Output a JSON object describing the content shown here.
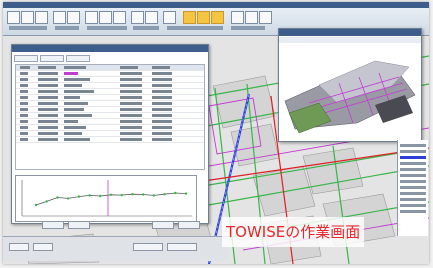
{
  "caption": {
    "text": "TOWISEの作業画面",
    "color": "#e8262b"
  },
  "app": {
    "accent": "#3d5d8a",
    "highlight_button": "#f5c542"
  },
  "cad": {
    "line_colors": {
      "green": "#39b54a",
      "red": "#e01f26",
      "blue": "#2b3fd8",
      "magenta": "#c23bd3",
      "gray": "#8c8c8c"
    }
  },
  "chart_data": {
    "type": "line",
    "series": [
      {
        "values": [
          0.3,
          0.42,
          0.55,
          0.52,
          0.58,
          0.62,
          0.6,
          0.64,
          0.63,
          0.66,
          0.65,
          0.62,
          0.66,
          0.7,
          0.68
        ]
      }
    ]
  }
}
